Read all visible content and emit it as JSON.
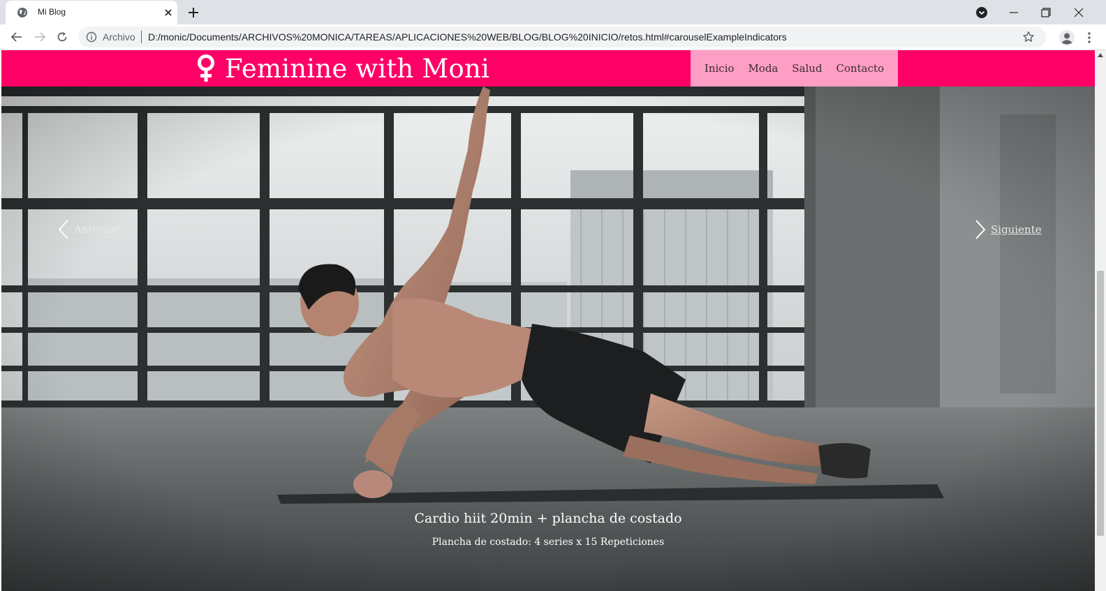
{
  "browser": {
    "tab_title": "Mi Blog",
    "omnibox_label": "Archivo",
    "url": "D:/monic/Documents/ARCHIVOS%20MONICA/TAREAS/APLICACIONES%20WEB/BLOG/BLOG%20INICIO/retos.html#carouselExampleIndicators"
  },
  "site": {
    "brand_symbol": "♀",
    "brand_title": "Feminine with Moni",
    "nav": [
      "Inicio",
      "Moda",
      "Salud",
      "Contacto"
    ]
  },
  "carousel": {
    "prev_label": "Anterior",
    "next_label": "Siguiente",
    "caption_title": "Cardio hiit 20min + plancha de costado",
    "caption_text": "Plancha de costado: 4 series x 15 Repeticiones"
  },
  "colors": {
    "navbar": "#ff0066",
    "nav_menu_bg": "#ff9ec5",
    "chrome_tabbar": "#dee1e6"
  },
  "icons": [
    "globe-icon",
    "close-icon",
    "plus-icon",
    "back-icon",
    "forward-icon",
    "reload-icon",
    "info-icon",
    "star-icon",
    "profile-icon",
    "kebab-menu-icon",
    "female-symbol-icon",
    "chevron-left-icon",
    "chevron-right-icon"
  ]
}
